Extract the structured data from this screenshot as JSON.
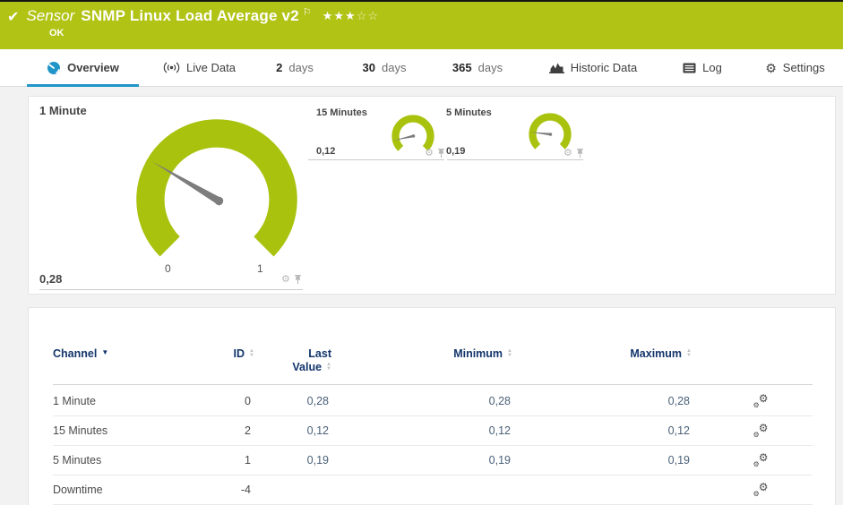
{
  "header": {
    "kind": "Sensor",
    "title": "SNMP Linux Load Average v2",
    "status": "OK",
    "stars_filled": "★★★",
    "stars_empty": "☆☆"
  },
  "icons": {
    "check": "✔",
    "flag": "⚐",
    "gear": "⚙"
  },
  "tabs": {
    "overview": "Overview",
    "live_data": "Live Data",
    "days2_num": "2",
    "days2_label": "days",
    "days30_num": "30",
    "days30_label": "days",
    "days365_num": "365",
    "days365_label": "days",
    "historic": "Historic Data",
    "log": "Log",
    "settings": "Settings"
  },
  "gauges": [
    {
      "name": "1 Minute",
      "value": 0.28,
      "value_display": "0,28",
      "min": 0,
      "max": 1,
      "scale_min": "0",
      "scale_max": "1"
    },
    {
      "name": "15 Minutes",
      "value": 0.12,
      "value_display": "0,12",
      "min": 0,
      "max": 1
    },
    {
      "name": "5 Minutes",
      "value": 0.19,
      "value_display": "0,19",
      "min": 0,
      "max": 1
    }
  ],
  "table": {
    "columns": {
      "channel": "Channel",
      "id": "ID",
      "last_line1": "Last",
      "last_line2": "Value",
      "minimum": "Minimum",
      "maximum": "Maximum"
    },
    "rows": [
      {
        "channel": "1 Minute",
        "id": "0",
        "last": "0,28",
        "min": "0,28",
        "max": "0,28"
      },
      {
        "channel": "15 Minutes",
        "id": "2",
        "last": "0,12",
        "min": "0,12",
        "max": "0,12"
      },
      {
        "channel": "5 Minutes",
        "id": "1",
        "last": "0,19",
        "min": "0,19",
        "max": "0,19"
      },
      {
        "channel": "Downtime",
        "id": "-4",
        "last": "",
        "min": "",
        "max": ""
      }
    ]
  },
  "colors": {
    "green": "#b1c315",
    "gauge_green": "#a9c20e",
    "blue": "#2095c8",
    "navy": "#13356b",
    "value_text": "#4a6078"
  }
}
